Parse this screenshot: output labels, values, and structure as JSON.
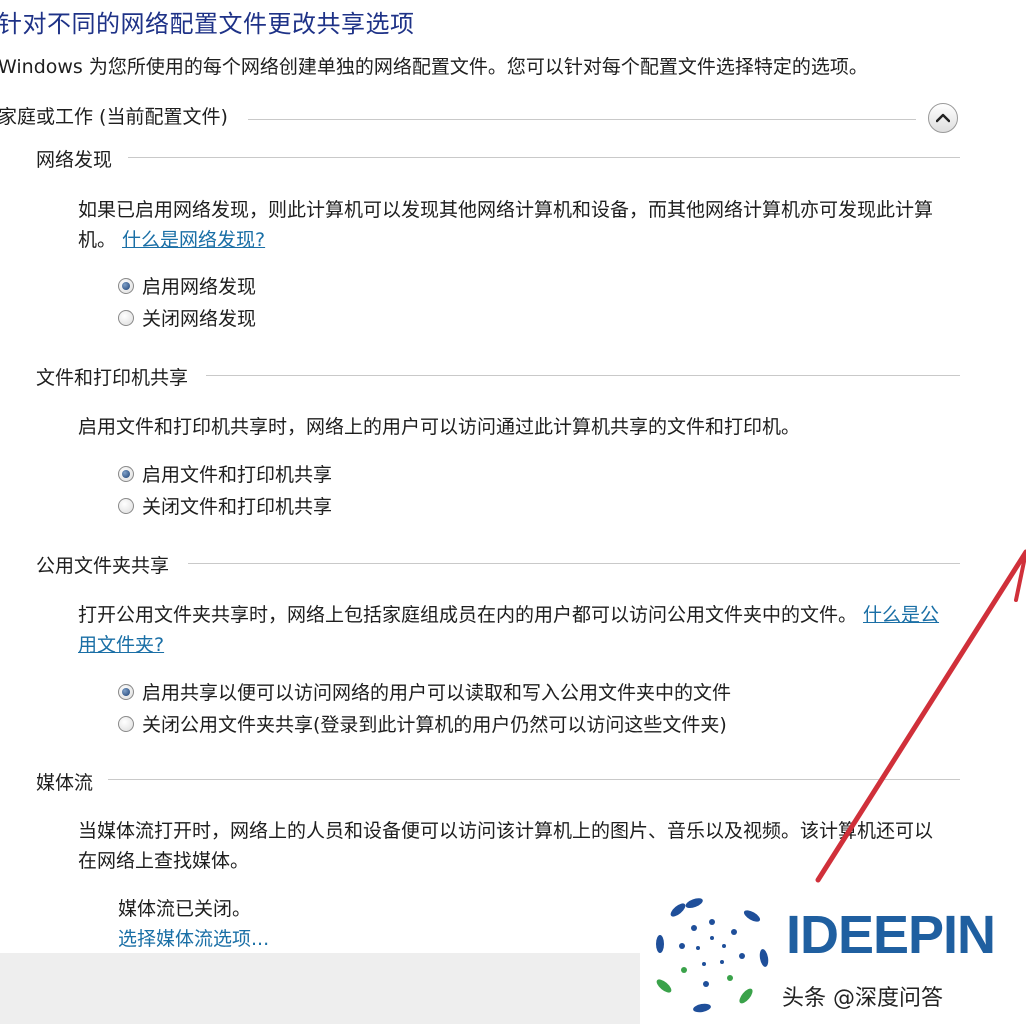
{
  "page": {
    "title": "针对不同的网络配置文件更改共享选项",
    "intro": "Windows 为您所使用的每个网络创建单独的网络配置文件。您可以针对每个配置文件选择特定的选项。",
    "group_header": "家庭或工作 (当前配置文件)"
  },
  "sections": {
    "discovery": {
      "title": "网络发现",
      "desc": "如果已启用网络发现，则此计算机可以发现其他网络计算机和设备，而其他网络计算机亦可发现此计算机。",
      "link": "什么是网络发现?",
      "options": [
        "启用网络发现",
        "关闭网络发现"
      ],
      "selected": 0
    },
    "file_sharing": {
      "title": "文件和打印机共享",
      "desc": "启用文件和打印机共享时，网络上的用户可以访问通过此计算机共享的文件和打印机。",
      "options": [
        "启用文件和打印机共享",
        "关闭文件和打印机共享"
      ],
      "selected": 0
    },
    "public_folder": {
      "title": "公用文件夹共享",
      "desc": "打开公用文件夹共享时，网络上包括家庭组成员在内的用户都可以访问公用文件夹中的文件。",
      "link": "什么是公用文件夹?",
      "options": [
        "启用共享以便可以访问网络的用户可以读取和写入公用文件夹中的文件",
        "关闭公用文件夹共享(登录到此计算机的用户仍然可以访问这些文件夹)"
      ],
      "selected": 0
    },
    "media": {
      "title": "媒体流",
      "desc": "当媒体流打开时，网络上的人员和设备便可以访问该计算机上的图片、音乐以及视频。该计算机还可以在网络上查找媒体。",
      "status": "媒体流已关闭。",
      "link": "选择媒体流选项..."
    }
  },
  "watermark": {
    "logo_text": "IDEEPIN",
    "caption": "头条 @深度问答"
  },
  "colors": {
    "title": "#1e3287",
    "link": "#1a6fa6",
    "annotation_arrow": "#d0303a",
    "logo_blue": "#1f5fa0",
    "logo_green": "#3aa24a"
  },
  "icons": {
    "collapse": "chevron-up-icon",
    "arrow": "red-arrow-annotation",
    "logo": "ideepin-spiral-logo"
  }
}
